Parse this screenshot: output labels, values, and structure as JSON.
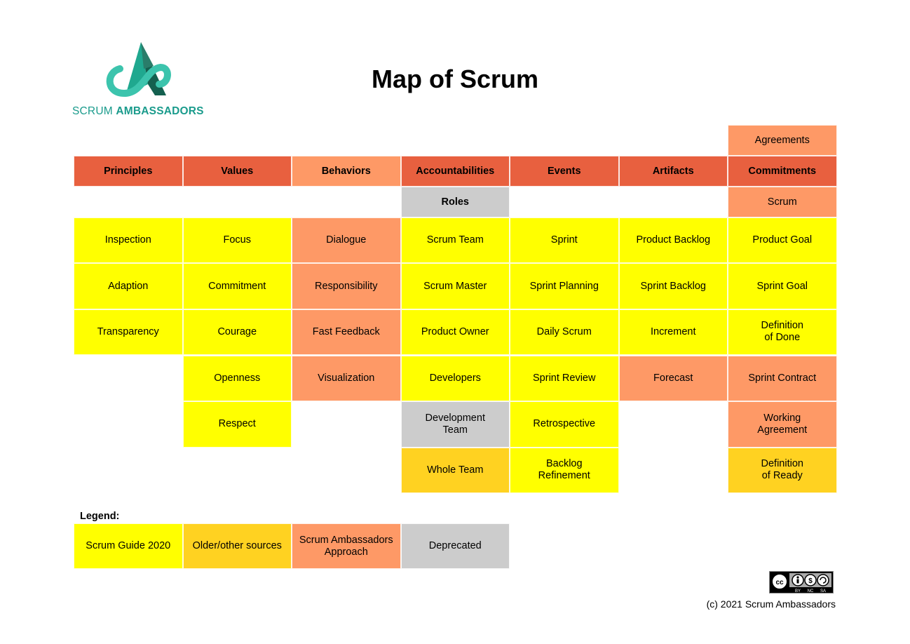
{
  "brand": {
    "name_light": "SCRUM",
    "name_bold": "AMBASSADORS",
    "color": "#1a9b8c"
  },
  "title": "Map of Scrum",
  "colors": {
    "header": "#e8603f",
    "scrum_ambassadors_approach": "#fe9966",
    "scrum_guide_2020": "#ffff00",
    "older_other_sources": "#ffd221",
    "deprecated": "#cccccc"
  },
  "columns": [
    {
      "header": "Principles",
      "header_color": "red",
      "sub": null,
      "items": [
        {
          "label": "Inspection",
          "color": "yellow"
        },
        {
          "label": "Adaption",
          "color": "yellow"
        },
        {
          "label": "Transparency",
          "color": "yellow"
        }
      ]
    },
    {
      "header": "Values",
      "header_color": "red",
      "sub": null,
      "items": [
        {
          "label": "Focus",
          "color": "yellow"
        },
        {
          "label": "Commitment",
          "color": "yellow"
        },
        {
          "label": "Courage",
          "color": "yellow"
        },
        {
          "label": "Openness",
          "color": "yellow"
        },
        {
          "label": "Respect",
          "color": "yellow"
        }
      ]
    },
    {
      "header": "Behaviors",
      "header_color": "salmon",
      "sub": null,
      "items": [
        {
          "label": "Dialogue",
          "color": "salmon"
        },
        {
          "label": "Responsibility",
          "color": "salmon"
        },
        {
          "label": "Fast Feedback",
          "color": "salmon"
        },
        {
          "label": "Visualization",
          "color": "salmon"
        }
      ]
    },
    {
      "header": "Accountabilities",
      "header_color": "red",
      "sub": {
        "label": "Roles",
        "color": "grey"
      },
      "items": [
        {
          "label": "Scrum Team",
          "color": "yellow"
        },
        {
          "label": "Scrum Master",
          "color": "yellow"
        },
        {
          "label": "Product Owner",
          "color": "yellow"
        },
        {
          "label": "Developers",
          "color": "yellow"
        },
        {
          "label": "Development\nTeam",
          "color": "grey"
        },
        {
          "label": "Whole Team",
          "color": "gold"
        }
      ]
    },
    {
      "header": "Events",
      "header_color": "red",
      "sub": null,
      "items": [
        {
          "label": "Sprint",
          "color": "yellow"
        },
        {
          "label": "Sprint Planning",
          "color": "yellow"
        },
        {
          "label": "Daily Scrum",
          "color": "yellow"
        },
        {
          "label": "Sprint Review",
          "color": "yellow"
        },
        {
          "label": "Retrospective",
          "color": "yellow"
        },
        {
          "label": "Backlog\nRefinement",
          "color": "yellow"
        }
      ]
    },
    {
      "header": "Artifacts",
      "header_color": "red",
      "sub": null,
      "items": [
        {
          "label": "Product Backlog",
          "color": "yellow"
        },
        {
          "label": "Sprint Backlog",
          "color": "yellow"
        },
        {
          "label": "Increment",
          "color": "yellow"
        },
        {
          "label": "Forecast",
          "color": "salmon"
        }
      ]
    },
    {
      "header": "Commitments",
      "header_color": "red",
      "above": {
        "label": "Agreements",
        "color": "salmon"
      },
      "sub": {
        "label": "Scrum",
        "color": "salmon"
      },
      "items": [
        {
          "label": "Product Goal",
          "color": "yellow"
        },
        {
          "label": "Sprint Goal",
          "color": "yellow"
        },
        {
          "label": "Definition\nof Done",
          "color": "yellow"
        },
        {
          "label": "Sprint Contract",
          "color": "salmon"
        },
        {
          "label": "Working\nAgreement",
          "color": "salmon"
        },
        {
          "label": "Definition\nof Ready",
          "color": "gold"
        }
      ]
    }
  ],
  "legend": {
    "label": "Legend:",
    "items": [
      {
        "label": "Scrum Guide 2020",
        "color": "yellow"
      },
      {
        "label": "Older/other sources",
        "color": "gold"
      },
      {
        "label": "Scrum Ambassadors\nApproach",
        "color": "salmon"
      },
      {
        "label": "Deprecated",
        "color": "grey"
      }
    ]
  },
  "license": {
    "badge": "CC BY-NC-SA",
    "parts": [
      "BY",
      "NC",
      "SA"
    ]
  },
  "copyright": "(c) 2021 Scrum Ambassadors"
}
